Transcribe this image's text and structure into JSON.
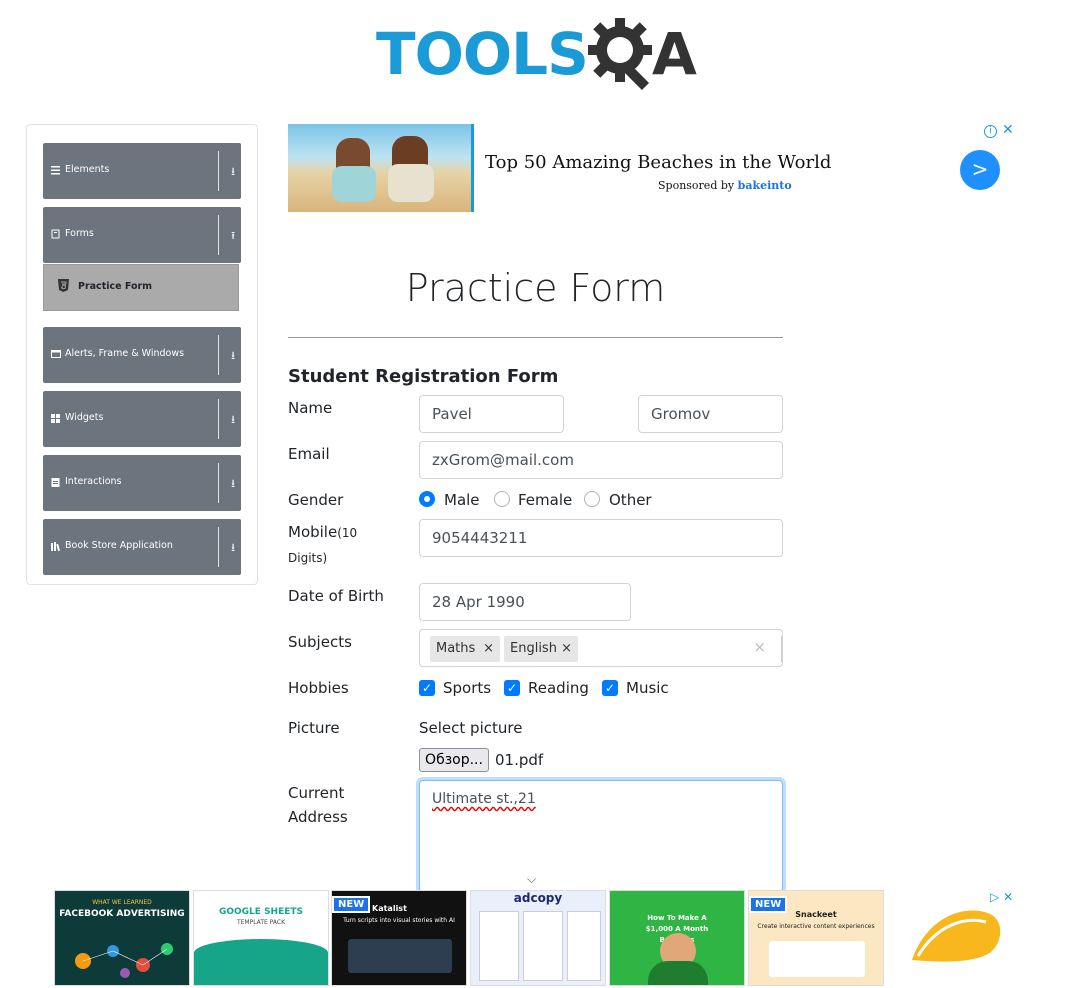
{
  "logo": {
    "tools": "TOOLS",
    "a": "A"
  },
  "sidebar": {
    "groups": [
      {
        "label": "Elements",
        "icon": "menu-icon"
      },
      {
        "label": "Forms",
        "icon": "form-icon"
      },
      {
        "label": "Alerts, Frame & Windows",
        "icon": "window-icon"
      },
      {
        "label": "Widgets",
        "icon": "grid-icon"
      },
      {
        "label": "Interactions",
        "icon": "interaction-icon"
      },
      {
        "label": "Book Store Application",
        "icon": "book-icon"
      }
    ],
    "sub_item": {
      "label": "Practice Form",
      "icon": "html5-icon"
    }
  },
  "ad_top": {
    "title": "Top 50 Amazing Beaches in the World",
    "sponsored_by": "Sponsored by",
    "sponsor": "bakeinto",
    "info": "i",
    "close": "✕",
    "go": ">"
  },
  "form": {
    "page_title": "Practice Form",
    "subtitle": "Student Registration Form",
    "name_label": "Name",
    "first_name": "Pavel",
    "last_name": "Gromov",
    "email_label": "Email",
    "email": "zxGrom@mail.com",
    "gender_label": "Gender",
    "gender_options": [
      "Male",
      "Female",
      "Other"
    ],
    "gender_selected": "Male",
    "mobile_label": "Mobile",
    "mobile_hint_1": "(10",
    "mobile_hint_2": "Digits)",
    "mobile": "9054443211",
    "dob_label": "Date of Birth",
    "dob": "28 Apr 1990",
    "subjects_label": "Subjects",
    "subjects": [
      "Maths",
      "English"
    ],
    "chip_remove": "×",
    "subjects_clear": "×",
    "hobbies_label": "Hobbies",
    "hobbies": [
      "Sports",
      "Reading",
      "Music"
    ],
    "checkmark": "✓",
    "picture_label": "Picture",
    "select_picture": "Select picture",
    "browse_button": "Обзор...",
    "file_name": "01.pdf",
    "address_label_1": "Current",
    "address_label_2": "Address",
    "address": "Ultimate st.,21"
  },
  "ad_bottom": {
    "tiles": [
      {
        "title": "FACEBOOK ADVERTISING",
        "sub": "WHAT WE LEARNED",
        "bg": "#0d3b3a",
        "fg": "#ffffff"
      },
      {
        "title": "GOOGLE SHEETS",
        "sub": "TEMPLATE PACK",
        "bg": "#17a589",
        "fg": "#ffffff"
      },
      {
        "title": "Katalist",
        "sub": "Turn scripts into visual stories with AI",
        "bg": "#111111",
        "fg": "#ffffff"
      },
      {
        "title": "adcopy",
        "sub": "",
        "bg": "#eaf0fb",
        "fg": "#1a2a6c"
      },
      {
        "title": "How To Make A $1,000 A Month Business",
        "sub": "",
        "bg": "#2fb544",
        "fg": "#ffffff"
      },
      {
        "title": "Snackeet",
        "sub": "Create interactive content experiences",
        "bg": "#fbe7c1",
        "fg": "#222222"
      }
    ],
    "new_badge": "NEW",
    "info": "▷",
    "close": "✕"
  }
}
